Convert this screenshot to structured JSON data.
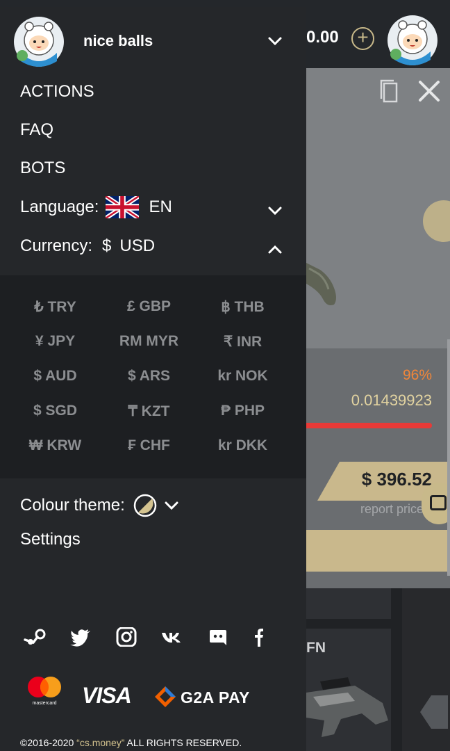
{
  "header": {
    "balance": "0.00",
    "username": "nice balls"
  },
  "menu": {
    "items": [
      {
        "label": "ACTIONS"
      },
      {
        "label": "FAQ"
      },
      {
        "label": "BOTS"
      }
    ],
    "language": {
      "label": "Language:",
      "value": "EN"
    },
    "currency": {
      "label": "Currency:",
      "symbol": "$",
      "value": "USD"
    },
    "currencies": [
      "₺ TRY",
      "£ GBP",
      "฿ THB",
      "¥ JPY",
      "RM MYR",
      "₹ INR",
      "$ AUD",
      "$ ARS",
      "kr NOK",
      "$ SGD",
      "₸ KZT",
      "₱ PHP",
      "₩ KRW",
      "₣ CHF",
      "kr DKK"
    ],
    "theme_label": "Colour theme:",
    "settings": "Settings"
  },
  "item_card": {
    "wear_percent": "96%",
    "float_value": "0.01439923",
    "price": "$ 396.52",
    "report": "report price",
    "condition": "FN",
    "wear_fraction": 0.96
  },
  "social_icons": [
    "steam-icon",
    "twitter-icon",
    "instagram-icon",
    "vk-icon",
    "discord-icon",
    "facebook-icon"
  ],
  "payments": {
    "mastercard": "mastercard",
    "visa": "VISA",
    "g2a": "G2A PAY"
  },
  "footer": {
    "prefix": "©2016-2020 ",
    "brand": "“cs.money”",
    "suffix": " ALL RIGHTS RESERVED."
  },
  "colors": {
    "gold": "#d4c38f",
    "accent_orange": "#f0863a",
    "red": "#e83a37",
    "menu_bg": "#25272a"
  }
}
